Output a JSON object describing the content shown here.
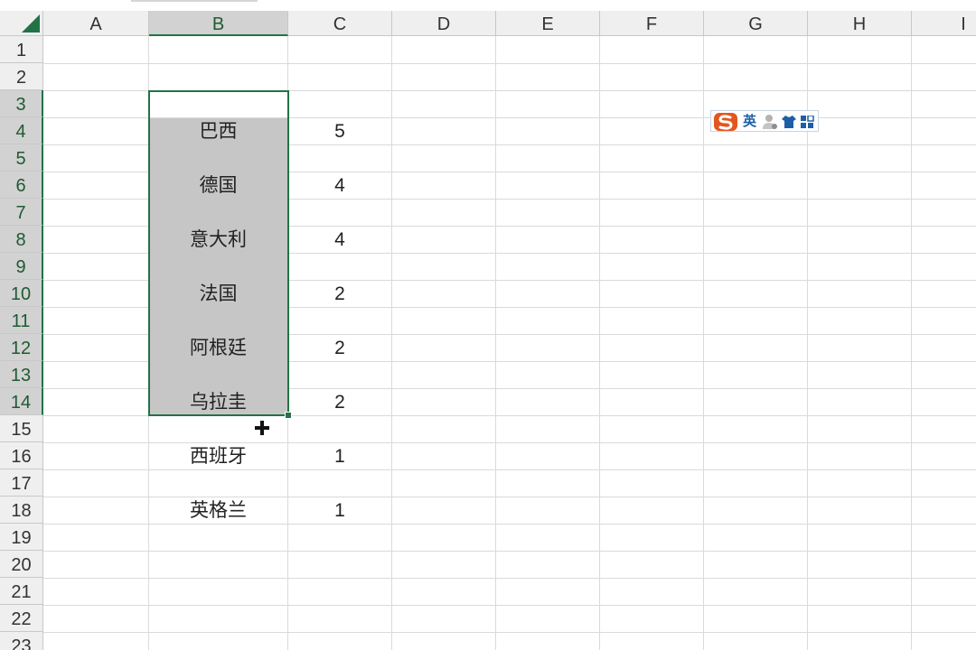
{
  "columns": [
    "A",
    "B",
    "C",
    "D",
    "E",
    "F",
    "G",
    "H",
    "I"
  ],
  "rows": [
    "1",
    "2",
    "3",
    "4",
    "5",
    "6",
    "7",
    "8",
    "9",
    "10",
    "11",
    "12",
    "13",
    "14",
    "15",
    "16",
    "17",
    "18",
    "19",
    "20",
    "21",
    "22",
    "23"
  ],
  "selection": {
    "range": "B3:B14",
    "highlighted_columns": [
      "B"
    ],
    "highlighted_rows": [
      "3",
      "4",
      "5",
      "6",
      "7",
      "8",
      "9",
      "10",
      "11",
      "12",
      "13",
      "14"
    ]
  },
  "cells": {
    "B4": "巴西",
    "C4": "5",
    "B6": "德国",
    "C6": "4",
    "B8": "意大利",
    "C8": "4",
    "B10": "法国",
    "C10": "2",
    "B12": "阿根廷",
    "C12": "2",
    "B14": "乌拉圭",
    "C14": "2",
    "B16": "西班牙",
    "C16": "1",
    "B18": "英格兰",
    "C18": "1"
  },
  "ime_toolbar": {
    "mode_label": "英",
    "icons": [
      "sogou-logo-icon",
      "user-icon",
      "skin-shirt-icon",
      "toolbox-icon"
    ]
  },
  "colors": {
    "accent": "#217346",
    "selection_fill": "#c6c6c6",
    "header_bg": "#efefef",
    "ime_blue": "#1d5fa6",
    "ime_orange": "#e2571e"
  }
}
